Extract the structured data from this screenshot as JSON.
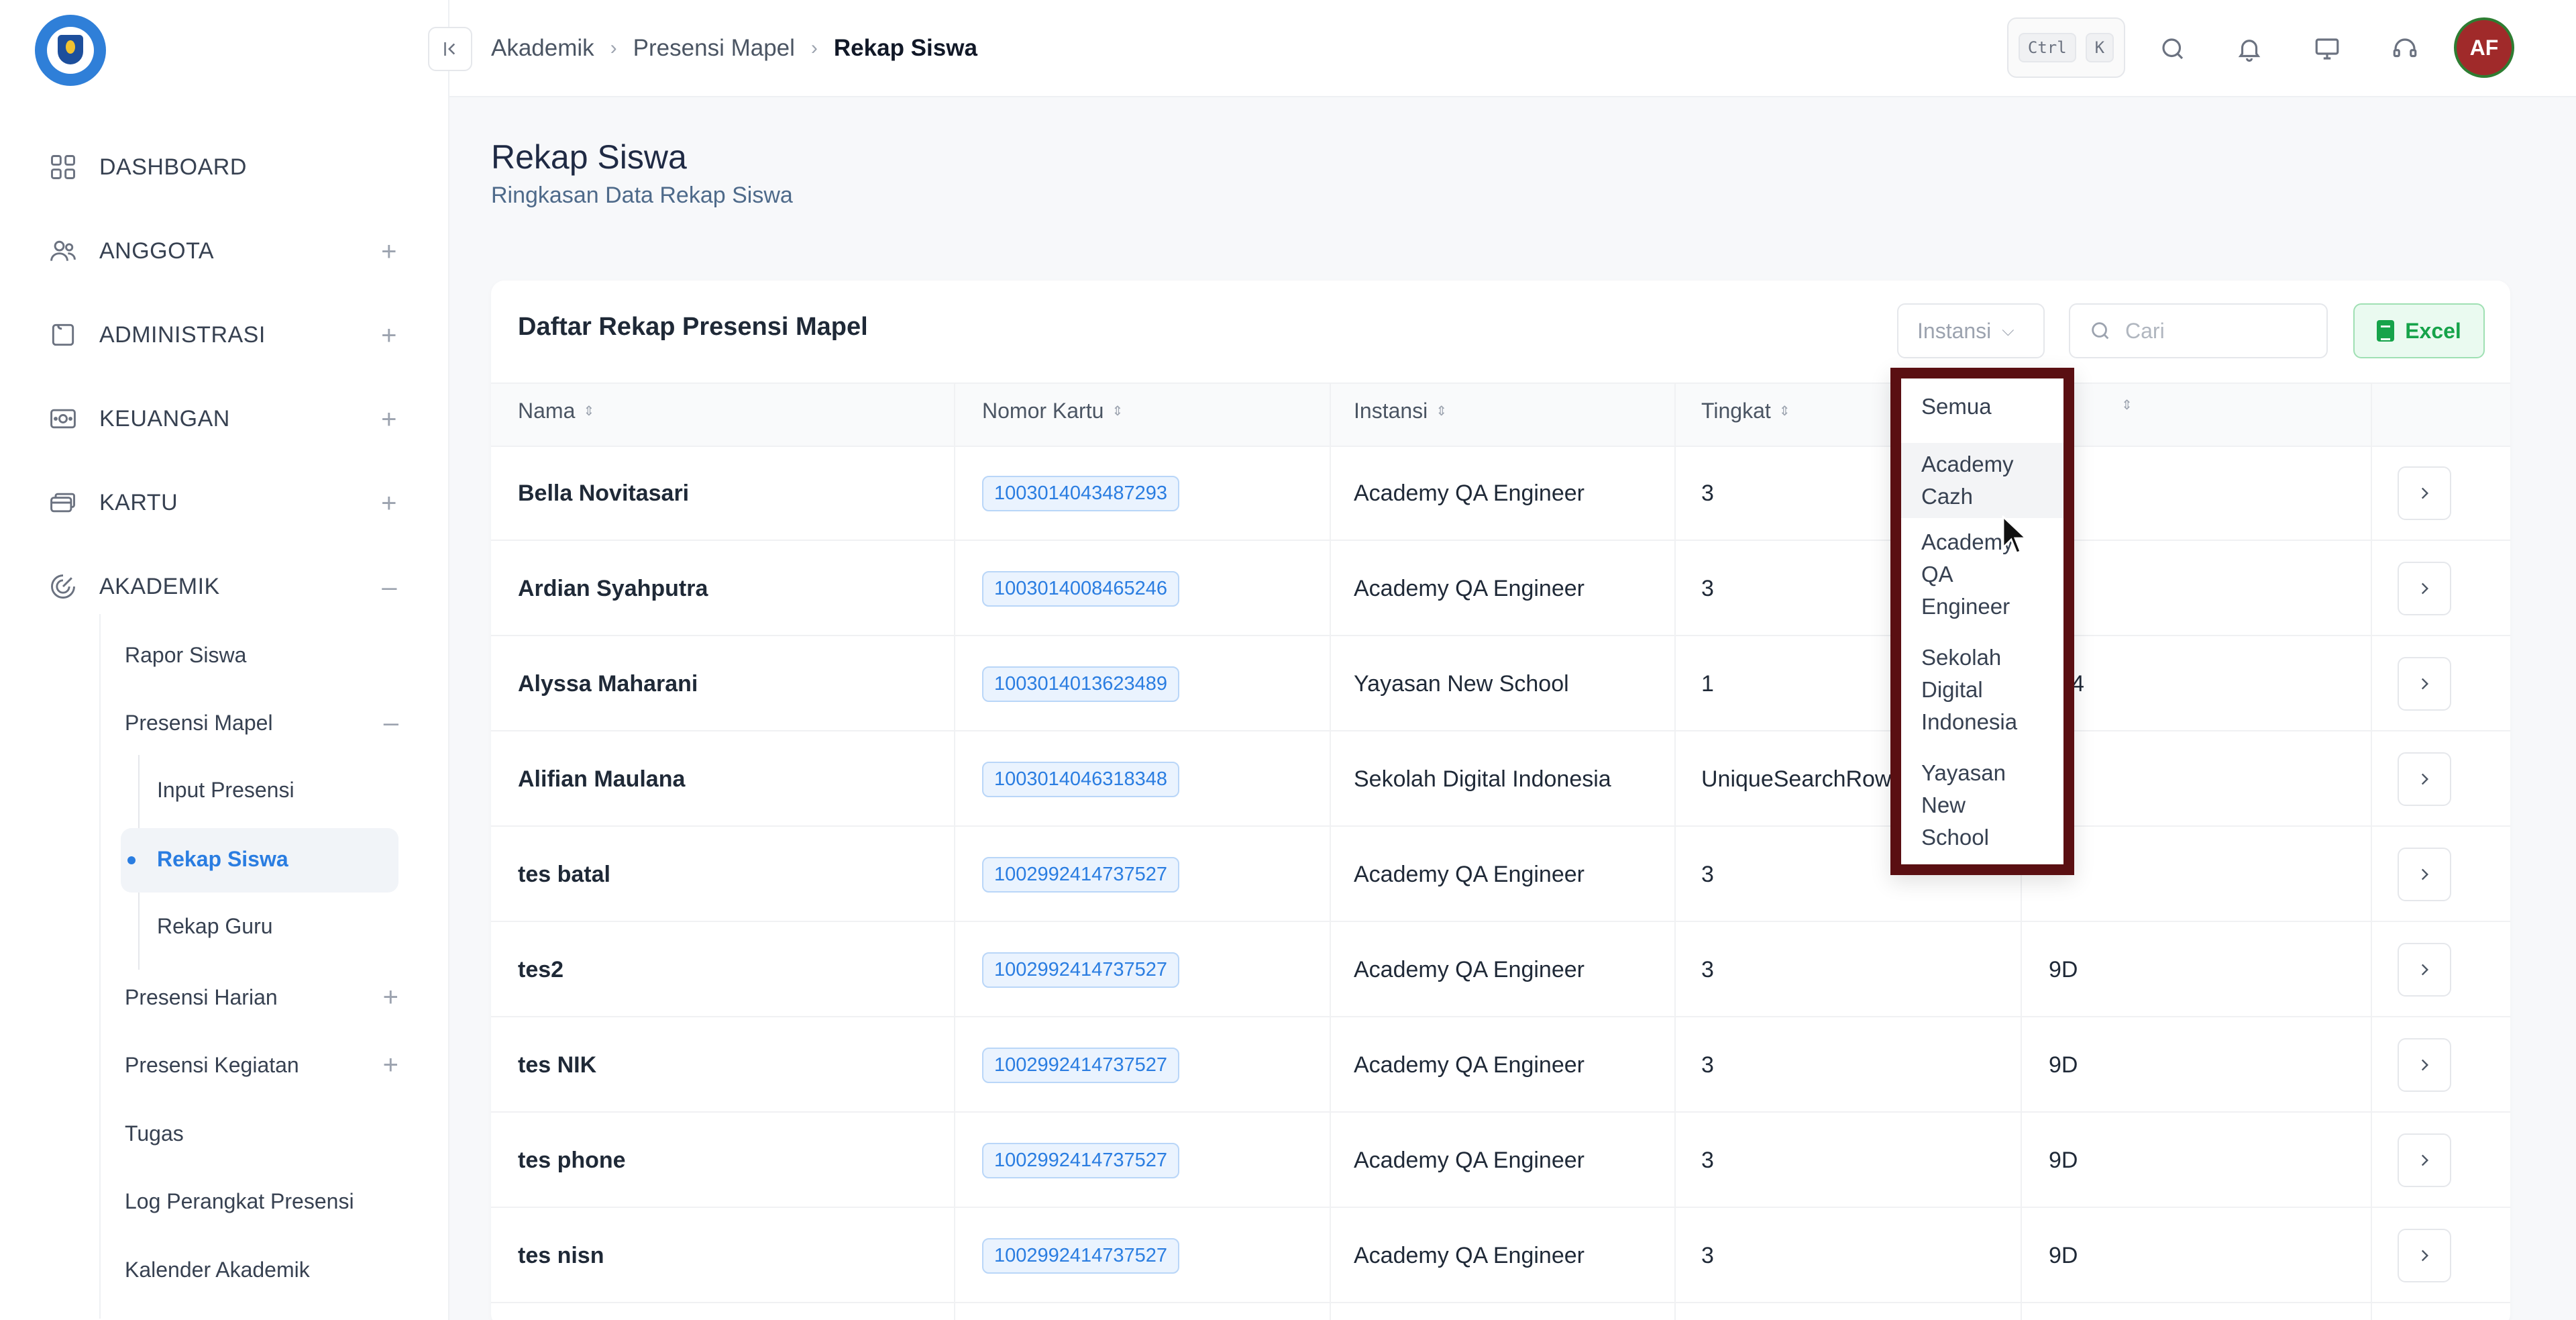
{
  "sidebar": {
    "nav": [
      {
        "label": "DASHBOARD",
        "icon": "grid-icon",
        "expand": ""
      },
      {
        "label": "ANGGOTA",
        "icon": "users-icon",
        "expand": "+"
      },
      {
        "label": "ADMINISTRASI",
        "icon": "folder-icon",
        "expand": "+"
      },
      {
        "label": "KEUANGAN",
        "icon": "money-icon",
        "expand": "+"
      },
      {
        "label": "KARTU",
        "icon": "cards-icon",
        "expand": "+"
      },
      {
        "label": "AKADEMIK",
        "icon": "academic-icon",
        "expand": "–"
      }
    ],
    "akademik_items": [
      {
        "label": "Rapor Siswa",
        "expand": ""
      },
      {
        "label": "Presensi Mapel",
        "expand": "–"
      },
      {
        "label": "Presensi Harian",
        "expand": "+"
      },
      {
        "label": "Presensi Kegiatan",
        "expand": "+"
      },
      {
        "label": "Tugas",
        "expand": ""
      },
      {
        "label": "Log Perangkat Presensi",
        "expand": ""
      },
      {
        "label": "Kalender Akademik",
        "expand": ""
      }
    ],
    "presensi_mapel_items": [
      {
        "label": "Input Presensi"
      },
      {
        "label": "Rekap Siswa",
        "active": true
      },
      {
        "label": "Rekap Guru"
      }
    ]
  },
  "topbar": {
    "breadcrumb": [
      "Akademik",
      "Presensi Mapel",
      "Rekap Siswa"
    ],
    "shortcut_keys": [
      "Ctrl",
      "K"
    ],
    "avatar_initials": "AF"
  },
  "page": {
    "title": "Rekap Siswa",
    "subtitle": "Ringkasan Data Rekap Siswa"
  },
  "card": {
    "title": "Daftar Rekap Presensi Mapel",
    "filter_label": "Instansi",
    "search_placeholder": "Cari",
    "excel_label": "Excel"
  },
  "table": {
    "columns": [
      "Nama",
      "Nomor Kartu",
      "Instansi",
      "Tingkat",
      ""
    ],
    "rows": [
      {
        "nama": "Bella Novitasari",
        "kartu": "1003014043487293",
        "instansi": "Academy QA Engineer",
        "tingkat": "3",
        "kelas": ""
      },
      {
        "nama": "Ardian Syahputra",
        "kartu": "1003014008465246",
        "instansi": "Academy QA Engineer",
        "tingkat": "3",
        "kelas": ""
      },
      {
        "nama": "Alyssa Maharani",
        "kartu": "1003014013623489",
        "instansi": "Yayasan New School",
        "tingkat": "1",
        "kelas": "A-4"
      },
      {
        "nama": "Alifian Maulana",
        "kartu": "1003014046318348",
        "instansi": "Sekolah Digital Indonesia",
        "tingkat": "UniqueSearchRow",
        "kelas": ""
      },
      {
        "nama": "tes batal",
        "kartu": "1002992414737527",
        "instansi": "Academy QA Engineer",
        "tingkat": "3",
        "kelas": ""
      },
      {
        "nama": "tes2",
        "kartu": "1002992414737527",
        "instansi": "Academy QA Engineer",
        "tingkat": "3",
        "kelas": "9D"
      },
      {
        "nama": "tes NIK",
        "kartu": "1002992414737527",
        "instansi": "Academy QA Engineer",
        "tingkat": "3",
        "kelas": "9D"
      },
      {
        "nama": "tes phone",
        "kartu": "1002992414737527",
        "instansi": "Academy QA Engineer",
        "tingkat": "3",
        "kelas": "9D"
      },
      {
        "nama": "tes nisn",
        "kartu": "1002992414737527",
        "instansi": "Academy QA Engineer",
        "tingkat": "3",
        "kelas": "9D"
      }
    ]
  },
  "dropdown": {
    "options": [
      {
        "lines": [
          "Semua"
        ]
      },
      {
        "lines": [
          "Academy",
          "Cazh"
        ],
        "hover": true
      },
      {
        "lines": [
          "Academy",
          "QA",
          "Engineer"
        ]
      },
      {
        "lines": [
          "Sekolah",
          "Digital",
          "Indonesia"
        ]
      },
      {
        "lines": [
          "Yayasan",
          "New",
          "School"
        ]
      }
    ]
  },
  "colors": {
    "accent": "#2a7de1",
    "excel_green": "#16a34a",
    "dropdown_highlight_border": "#5a0f12",
    "avatar_bg": "#a02a2a"
  }
}
